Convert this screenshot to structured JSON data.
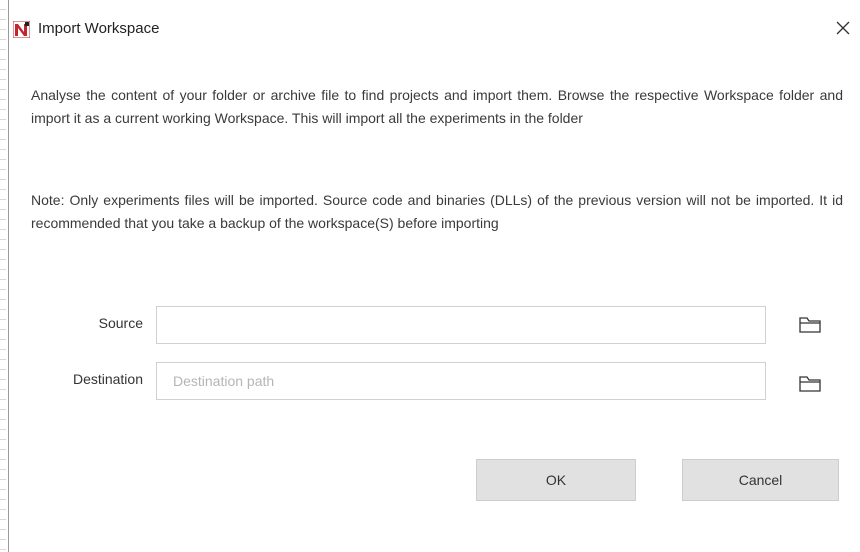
{
  "window": {
    "title": "Import Workspace",
    "app_icon": "app-logo-icon",
    "close_icon": "close-icon"
  },
  "content": {
    "description": "Analyse the content of your folder or archive file to find projects and import them. Browse the respective Workspace folder and import it as a current working Workspace. This will import all the experiments in the folder",
    "note": "Note: Only experiments files will be imported. Source code and binaries (DLLs) of the previous version will not be imported. It id recommended that you take a backup of the workspace(S) before importing"
  },
  "form": {
    "source": {
      "label": "Source",
      "value": "",
      "placeholder": "",
      "browse_icon": "folder-icon"
    },
    "destination": {
      "label": "Destination",
      "value": "",
      "placeholder": "Destination path",
      "browse_icon": "folder-icon"
    }
  },
  "buttons": {
    "ok_label": "OK",
    "cancel_label": "Cancel"
  },
  "colors": {
    "logo_red": "#c0282d",
    "button_bg": "#e1e1e1",
    "input_border": "#d0d0d0",
    "placeholder": "#b5b5b5"
  }
}
